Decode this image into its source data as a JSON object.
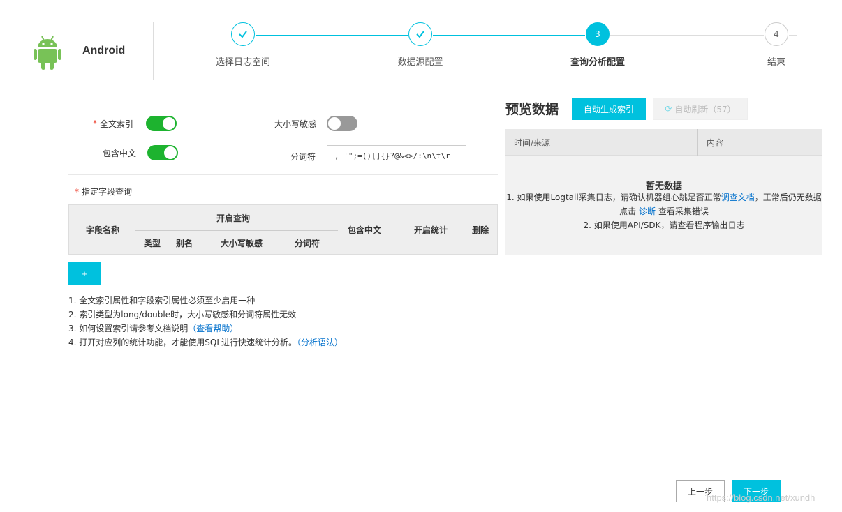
{
  "platform": {
    "name": "Android",
    "icon": "android-icon"
  },
  "steps": [
    {
      "number": "1",
      "label": "选择日志空间",
      "state": "done"
    },
    {
      "number": "2",
      "label": "数据源配置",
      "state": "done"
    },
    {
      "number": "3",
      "label": "查询分析配置",
      "state": "active"
    },
    {
      "number": "4",
      "label": "结束",
      "state": "todo"
    }
  ],
  "form": {
    "fulltext_label": "全文索引",
    "fulltext_on": true,
    "case_sensitive_label": "大小写敏感",
    "case_sensitive_on": false,
    "include_chinese_label": "包含中文",
    "include_chinese_on": true,
    "separator_label": "分词符",
    "separator_value": ", '\";=()[]{}?@&<>/:\\n\\t\\r",
    "field_query_label": "指定字段查询"
  },
  "field_table": {
    "field_name": "字段名称",
    "enable_query": "开启查询",
    "type": "类型",
    "alias": "别名",
    "case_sensitive": "大小写敏感",
    "separator": "分词符",
    "include_chinese": "包含中文",
    "enable_stats": "开启统计",
    "delete": "删除"
  },
  "add_button": "+",
  "notes": {
    "n1": "1. 全文索引属性和字段索引属性必须至少启用一种",
    "n2": "2. 索引类型为long/double时，大小写敏感和分词符属性无效",
    "n3_text": "3. 如何设置索引请参考文档说明",
    "n3_link": "（查看帮助）",
    "n4_text": "4. 打开对应列的统计功能，才能使用SQL进行快速统计分析。",
    "n4_link": "（分析语法）"
  },
  "preview": {
    "title": "预览数据",
    "auto_index_button": "自动生成索引",
    "auto_refresh_button": "自动刷新（57）",
    "col_time": "时间/来源",
    "col_content": "内容",
    "empty_title": "暂无数据",
    "empty_line1_a": "1. 如果使用Logtail采集日志，请确认机器组心跳是否正常",
    "empty_line1_link": "调查文档",
    "empty_line1_b": "，正常后仍无数据",
    "empty_line2_a": "点击 ",
    "empty_line2_link": "诊断",
    "empty_line2_b": " 查看采集错误",
    "empty_line3": "2. 如果使用API/SDK，请查看程序输出日志"
  },
  "footer": {
    "prev_button": "上一步",
    "next_button": "下一步",
    "watermark": "https://blog.csdn.net/xundh"
  },
  "colors": {
    "accent": "#00c1de",
    "toggle_on": "#1db32f",
    "link": "#0070cc"
  }
}
